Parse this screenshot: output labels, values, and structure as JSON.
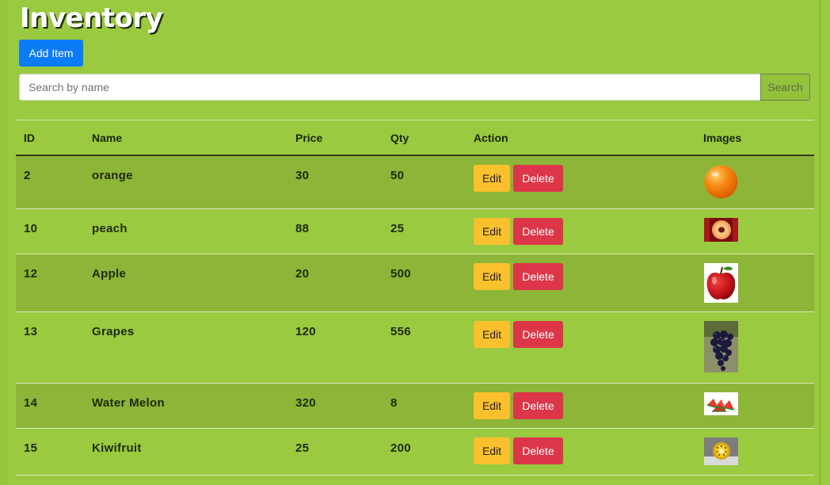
{
  "page": {
    "title": "Inventory"
  },
  "toolbar": {
    "add_label": "Add Item"
  },
  "search": {
    "placeholder": "Search by name",
    "value": "",
    "button_label": "Search"
  },
  "table": {
    "headers": {
      "id": "ID",
      "name": "Name",
      "price": "Price",
      "qty": "Qty",
      "action": "Action",
      "images": "Images"
    },
    "edit_label": "Edit",
    "delete_label": "Delete",
    "rows": [
      {
        "id": "2",
        "name": "orange",
        "price": "30",
        "qty": "50",
        "image": "orange-icon"
      },
      {
        "id": "10",
        "name": "peach",
        "price": "88",
        "qty": "25",
        "image": "peach-icon"
      },
      {
        "id": "12",
        "name": "Apple",
        "price": "20",
        "qty": "500",
        "image": "apple-icon"
      },
      {
        "id": "13",
        "name": "Grapes",
        "price": "120",
        "qty": "556",
        "image": "grapes-icon"
      },
      {
        "id": "14",
        "name": "Water Melon",
        "price": "320",
        "qty": "8",
        "image": "watermelon-icon"
      },
      {
        "id": "15",
        "name": "Kiwifruit",
        "price": "25",
        "qty": "200",
        "image": "kiwi-icon"
      }
    ]
  },
  "colors": {
    "background": "#9aca3f",
    "primary": "#0b7cf5",
    "warning": "#fbc02d",
    "danger": "#dc3648"
  }
}
